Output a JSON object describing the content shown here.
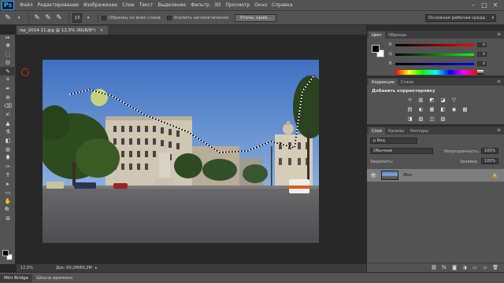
{
  "app": {
    "logo": "Ps",
    "menu": [
      "Файл",
      "Редактирование",
      "Изображение",
      "Слои",
      "Текст",
      "Выделение",
      "Фильтр",
      "3D",
      "Просмотр",
      "Окно",
      "Справка"
    ],
    "window_controls": [
      "–",
      "□",
      "✕"
    ]
  },
  "options": {
    "brush_size": "13",
    "sample_all_layers": "Образец со всех слоев",
    "auto_enhance": "Усилить автоматически",
    "refine_edge": "Уточн. край...",
    "workspace": "Основная рабочая среда"
  },
  "document": {
    "tab_title": "isp_2014-11.jpg @ 12,5% (RGB/8*)",
    "tab_close": "×",
    "zoom": "12,5%",
    "doc_size": "Док: 60,2M/60,2M"
  },
  "bottom_tabs": [
    "Mini Bridge",
    "Шкала времени"
  ],
  "color_panel": {
    "tabs": [
      "Цвет",
      "Образцы"
    ],
    "channels": [
      {
        "label": "R",
        "value": "0",
        "gradient": "linear-gradient(to right, #000, #f00)"
      },
      {
        "label": "G",
        "value": "0",
        "gradient": "linear-gradient(to right, #000, #0f0)"
      },
      {
        "label": "B",
        "value": "0",
        "gradient": "linear-gradient(to right, #000, #00f)"
      }
    ]
  },
  "adjustments_panel": {
    "tabs": [
      "Коррекция",
      "Стили"
    ],
    "title": "Добавить корректировку",
    "row1": [
      "☼",
      "▥",
      "◩",
      "◪",
      "▽"
    ],
    "row2": [
      "▤",
      "◐",
      "▦",
      "◧",
      "◉",
      "▩"
    ],
    "row3": [
      "◨",
      "▧",
      "◫",
      "▨"
    ]
  },
  "layers_panel": {
    "tabs": [
      "Слои",
      "Каналы",
      "Контуры"
    ],
    "filter_label": "ρ Вид",
    "blend_mode": "Обычные",
    "opacity_label": "Непрозрачность:",
    "opacity_value": "100%",
    "lock_label": "Закрепить:",
    "fill_label": "Заливка:",
    "fill_value": "100%",
    "layer": {
      "name": "Фон",
      "eye": "👁",
      "lock": "🔒"
    },
    "footer_icons": [
      "⛓",
      "fx",
      "◙",
      "◑",
      "▭",
      "▫",
      "🗑"
    ]
  },
  "tools": [
    "▸▸",
    "✥",
    "⬚",
    "ʘ",
    "✎",
    "⌗",
    "✒",
    "⊕",
    "⌫",
    "✍",
    "▲",
    "⚗",
    "◧",
    "◍",
    "⬮",
    "✑",
    "T",
    "▸",
    "▭",
    "✋",
    "🔍",
    "⊞"
  ],
  "colors": {
    "accent": "#31a8ff",
    "panel_bg": "#535353",
    "canvas_bg": "#282828",
    "layer_selected": "#7d7d7d"
  }
}
